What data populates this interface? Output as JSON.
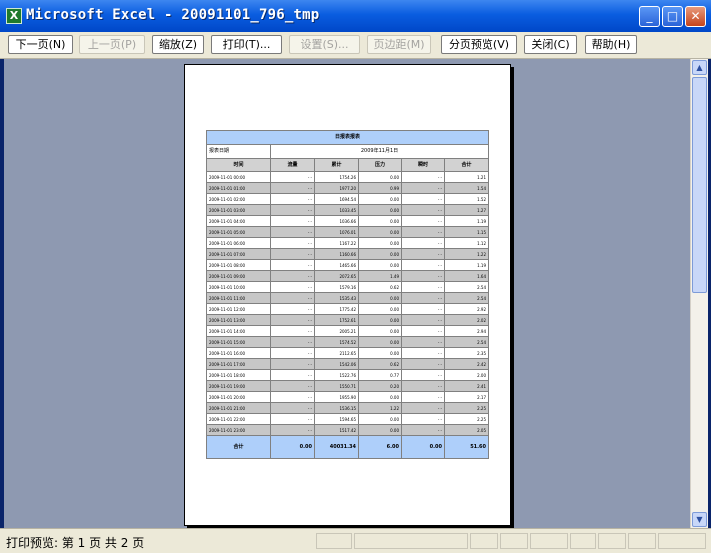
{
  "window": {
    "title": "Microsoft Excel - 20091101_796_tmp",
    "app_icon_glyph": "X",
    "minimize_glyph": "_",
    "maximize_glyph": "□",
    "close_glyph": "✕"
  },
  "toolbar": {
    "next": "下一页(N)",
    "prev": "上一页(P)",
    "zoom": "缩放(Z)",
    "print": "打印(T)...",
    "setup": "设置(S)...",
    "margins": "页边距(M)",
    "page_break": "分页预览(V)",
    "close": "关闭(C)",
    "help": "帮助(H)"
  },
  "status": {
    "text": "打印预览: 第 1 页  共 2 页"
  },
  "report": {
    "title": "日报表报表",
    "info_label": "报表日期",
    "info_value": "2009年11月1日",
    "headers": [
      "时间",
      "流量",
      "累计",
      "压力",
      "瞬时",
      "合计"
    ],
    "rows": [
      [
        "2009-11-01 00:00",
        "- -",
        "1754.26",
        "0.00",
        "- -",
        "1.21"
      ],
      [
        "2009-11-01 01:00",
        "- -",
        "1977.20",
        "0.99",
        "- -",
        "1.54"
      ],
      [
        "2009-11-01 02:00",
        "- -",
        "1694.54",
        "0.00",
        "- -",
        "1.52"
      ],
      [
        "2009-11-01 03:00",
        "- -",
        "1033.45",
        "0.00",
        "- -",
        "1.27"
      ],
      [
        "2009-11-01 04:00",
        "- -",
        "1036.66",
        "0.00",
        "- -",
        "1.19"
      ],
      [
        "2009-11-01 05:00",
        "- -",
        "1076.01",
        "0.00",
        "- -",
        "1.15"
      ],
      [
        "2009-11-01 06:00",
        "- -",
        "1167.22",
        "0.00",
        "- -",
        "1.12"
      ],
      [
        "2009-11-01 07:00",
        "- -",
        "1160.66",
        "0.00",
        "- -",
        "1.22"
      ],
      [
        "2009-11-01 08:00",
        "- -",
        "1465.66",
        "0.00",
        "- -",
        "1.19"
      ],
      [
        "2009-11-01 09:00",
        "- -",
        "2072.65",
        "1.49",
        "- -",
        "1.64"
      ],
      [
        "2009-11-01 10:00",
        "- -",
        "1579.16",
        "0.62",
        "- -",
        "2.54"
      ],
      [
        "2009-11-01 11:00",
        "- -",
        "1535.43",
        "0.00",
        "- -",
        "2.54"
      ],
      [
        "2009-11-01 12:00",
        "- -",
        "1775.42",
        "0.00",
        "- -",
        "2.92"
      ],
      [
        "2009-11-01 13:00",
        "- -",
        "1752.61",
        "0.00",
        "- -",
        "2.02"
      ],
      [
        "2009-11-01 14:00",
        "- -",
        "2005.21",
        "0.00",
        "- -",
        "2.94"
      ],
      [
        "2009-11-01 15:00",
        "- -",
        "1574.52",
        "0.00",
        "- -",
        "2.54"
      ],
      [
        "2009-11-01 16:00",
        "- -",
        "2112.65",
        "0.00",
        "- -",
        "2.35"
      ],
      [
        "2009-11-01 17:00",
        "- -",
        "1542.06",
        "0.62",
        "- -",
        "2.42"
      ],
      [
        "2009-11-01 18:00",
        "- -",
        "1522.76",
        "0.77",
        "- -",
        "2.00"
      ],
      [
        "2009-11-01 19:00",
        "- -",
        "1550.71",
        "0.20",
        "- -",
        "2.41"
      ],
      [
        "2009-11-01 20:00",
        "- -",
        "1955.90",
        "0.00",
        "- -",
        "2.17"
      ],
      [
        "2009-11-01 21:00",
        "- -",
        "1536.15",
        "1.22",
        "- -",
        "2.25"
      ],
      [
        "2009-11-01 22:00",
        "- -",
        "1594.65",
        "0.00",
        "- -",
        "2.25"
      ],
      [
        "2009-11-01 23:00",
        "- -",
        "1517.42",
        "0.00",
        "- -",
        "2.05"
      ]
    ],
    "total": [
      "合计",
      "0.00",
      "40031.34",
      "6.00",
      "0.00",
      "51.60"
    ]
  },
  "colors": {
    "title_bar": "#0a5de0",
    "preview_bg": "#8e99b1",
    "report_header": "#aecffa",
    "row_gray": "#c7c7c7"
  }
}
